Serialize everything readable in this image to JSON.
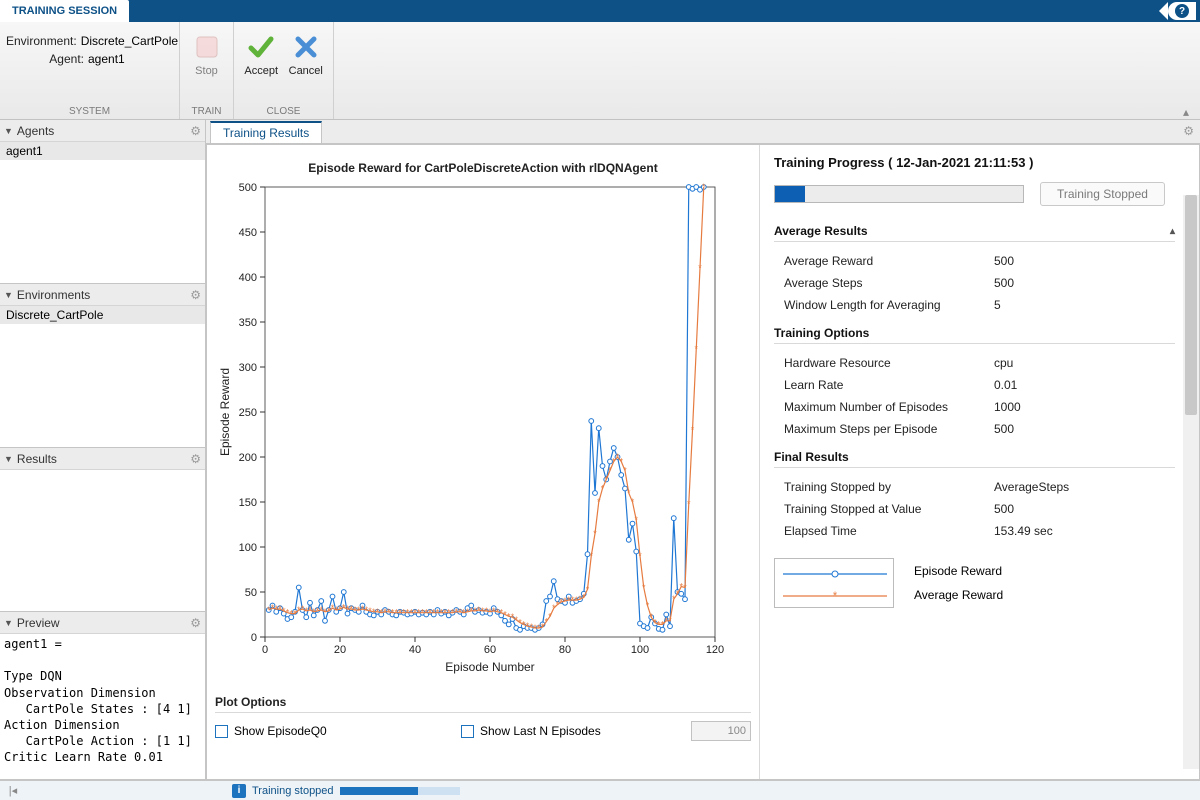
{
  "title_tab": "TRAINING SESSION",
  "system": {
    "env_label": "Environment:",
    "env_value": "Discrete_CartPole",
    "agent_label": "Agent:",
    "agent_value": "agent1",
    "group_label": "SYSTEM"
  },
  "train": {
    "stop": "Stop",
    "group_label": "TRAIN"
  },
  "close": {
    "accept": "Accept",
    "cancel": "Cancel",
    "group_label": "CLOSE"
  },
  "panels": {
    "agents": {
      "title": "Agents",
      "item": "agent1"
    },
    "envs": {
      "title": "Environments",
      "item": "Discrete_CartPole"
    },
    "results": {
      "title": "Results"
    },
    "preview": {
      "title": "Preview",
      "text": "agent1 =\n\nType DQN\nObservation Dimension\n   CartPole States : [4 1]\nAction Dimension\n   CartPole Action : [1 1]\nCritic Learn Rate 0.01"
    }
  },
  "doc_tab": "Training Results",
  "chart_data": {
    "type": "line",
    "title": "Episode Reward for CartPoleDiscreteAction with rlDQNAgent",
    "xlabel": "Episode Number",
    "ylabel": "Episode Reward",
    "xlim": [
      0,
      120
    ],
    "ylim": [
      0,
      500
    ],
    "xticks": [
      0,
      20,
      40,
      60,
      80,
      100,
      120
    ],
    "yticks": [
      0,
      50,
      100,
      150,
      200,
      250,
      300,
      350,
      400,
      450,
      500
    ],
    "series": [
      {
        "name": "Episode Reward",
        "color": "#1f77d4",
        "marker": "o",
        "x": [
          1,
          2,
          3,
          4,
          5,
          6,
          7,
          8,
          9,
          10,
          11,
          12,
          13,
          14,
          15,
          16,
          17,
          18,
          19,
          20,
          21,
          22,
          23,
          24,
          25,
          26,
          27,
          28,
          29,
          30,
          31,
          32,
          33,
          34,
          35,
          36,
          37,
          38,
          39,
          40,
          41,
          42,
          43,
          44,
          45,
          46,
          47,
          48,
          49,
          50,
          51,
          52,
          53,
          54,
          55,
          56,
          57,
          58,
          59,
          60,
          61,
          62,
          63,
          64,
          65,
          66,
          67,
          68,
          69,
          70,
          71,
          72,
          73,
          74,
          75,
          76,
          77,
          78,
          79,
          80,
          81,
          82,
          83,
          84,
          85,
          86,
          87,
          88,
          89,
          90,
          91,
          92,
          93,
          94,
          95,
          96,
          97,
          98,
          99,
          100,
          101,
          102,
          103,
          104,
          105,
          106,
          107,
          108,
          109,
          110,
          111,
          112,
          113,
          114,
          115,
          116,
          117
        ],
        "y": [
          30,
          35,
          28,
          32,
          26,
          20,
          22,
          28,
          55,
          30,
          22,
          38,
          24,
          30,
          40,
          18,
          30,
          45,
          28,
          32,
          50,
          26,
          32,
          30,
          28,
          35,
          28,
          25,
          24,
          28,
          25,
          30,
          28,
          25,
          24,
          28,
          27,
          25,
          26,
          28,
          25,
          27,
          25,
          28,
          25,
          30,
          26,
          28,
          24,
          27,
          30,
          28,
          25,
          32,
          35,
          28,
          30,
          27,
          28,
          26,
          32,
          28,
          24,
          18,
          14,
          20,
          10,
          8,
          12,
          10,
          10,
          8,
          10,
          14,
          40,
          45,
          62,
          42,
          40,
          38,
          45,
          38,
          40,
          42,
          48,
          92,
          240,
          160,
          232,
          190,
          175,
          195,
          210,
          200,
          180,
          165,
          108,
          126,
          95,
          15,
          12,
          10,
          22,
          15,
          9,
          8,
          25,
          12,
          132,
          50,
          48,
          42,
          500,
          498,
          500,
          497,
          500
        ]
      },
      {
        "name": "Average Reward",
        "color": "#e67b40",
        "marker": "*",
        "x": [
          1,
          2,
          3,
          4,
          5,
          6,
          7,
          8,
          9,
          10,
          11,
          12,
          13,
          14,
          15,
          16,
          17,
          18,
          19,
          20,
          21,
          22,
          23,
          24,
          25,
          26,
          27,
          28,
          29,
          30,
          31,
          32,
          33,
          34,
          35,
          36,
          37,
          38,
          39,
          40,
          41,
          42,
          43,
          44,
          45,
          46,
          47,
          48,
          49,
          50,
          51,
          52,
          53,
          54,
          55,
          56,
          57,
          58,
          59,
          60,
          61,
          62,
          63,
          64,
          65,
          66,
          67,
          68,
          69,
          70,
          71,
          72,
          73,
          74,
          75,
          76,
          77,
          78,
          79,
          80,
          81,
          82,
          83,
          84,
          85,
          86,
          87,
          88,
          89,
          90,
          91,
          92,
          93,
          94,
          95,
          96,
          97,
          98,
          99,
          100,
          101,
          102,
          103,
          104,
          105,
          106,
          107,
          108,
          109,
          110,
          111,
          112,
          113,
          114,
          115,
          116,
          117
        ],
        "y": [
          30,
          32,
          31,
          31,
          29,
          27,
          26,
          26,
          30,
          31,
          29,
          30,
          28,
          29,
          30,
          28,
          29,
          32,
          30,
          31,
          33,
          31,
          31,
          30,
          30,
          31,
          30,
          29,
          28,
          28,
          27,
          28,
          28,
          27,
          27,
          27,
          27,
          27,
          27,
          27,
          27,
          27,
          27,
          27,
          27,
          27,
          27,
          27,
          27,
          27,
          28,
          28,
          27,
          28,
          29,
          29,
          30,
          29,
          29,
          28,
          29,
          28,
          27,
          25,
          23,
          22,
          19,
          16,
          14,
          12,
          11,
          10,
          10,
          11,
          17,
          23,
          32,
          36,
          39,
          40,
          41,
          41,
          41,
          42,
          44,
          53,
          90,
          115,
          150,
          165,
          175,
          185,
          195,
          200,
          195,
          185,
          160,
          150,
          130,
          90,
          55,
          35,
          22,
          16,
          14,
          14,
          18,
          18,
          42,
          48,
          56,
          55,
          148,
          230,
          320,
          410,
          500
        ]
      }
    ]
  },
  "plot_options": {
    "heading": "Plot Options",
    "show_q0": "Show EpisodeQ0",
    "show_last_n": "Show Last N Episodes",
    "n_value": "100"
  },
  "progress": {
    "title": "Training Progress ( 12-Jan-2021 21:11:53 )",
    "progress_pct": 12,
    "status": "Training Stopped",
    "sections": {
      "avg": {
        "heading": "Average Results",
        "rows": [
          [
            "Average Reward",
            "500"
          ],
          [
            "Average Steps",
            "500"
          ],
          [
            "Window Length for Averaging",
            "5"
          ]
        ]
      },
      "opts": {
        "heading": "Training Options",
        "rows": [
          [
            "Hardware Resource",
            "cpu"
          ],
          [
            "Learn Rate",
            "0.01"
          ],
          [
            "Maximum Number of Episodes",
            "1000"
          ],
          [
            "Maximum Steps per Episode",
            "500"
          ]
        ]
      },
      "final": {
        "heading": "Final Results",
        "rows": [
          [
            "Training Stopped by",
            "AverageSteps"
          ],
          [
            "Training Stopped at Value",
            "500"
          ],
          [
            "Elapsed Time",
            "153.49 sec"
          ]
        ]
      }
    },
    "legend": [
      [
        "Episode Reward",
        "#1f77d4",
        "o"
      ],
      [
        "Average Reward",
        "#e67b40",
        "*"
      ]
    ]
  },
  "statusbar": {
    "text": "Training stopped",
    "pct": 65
  }
}
